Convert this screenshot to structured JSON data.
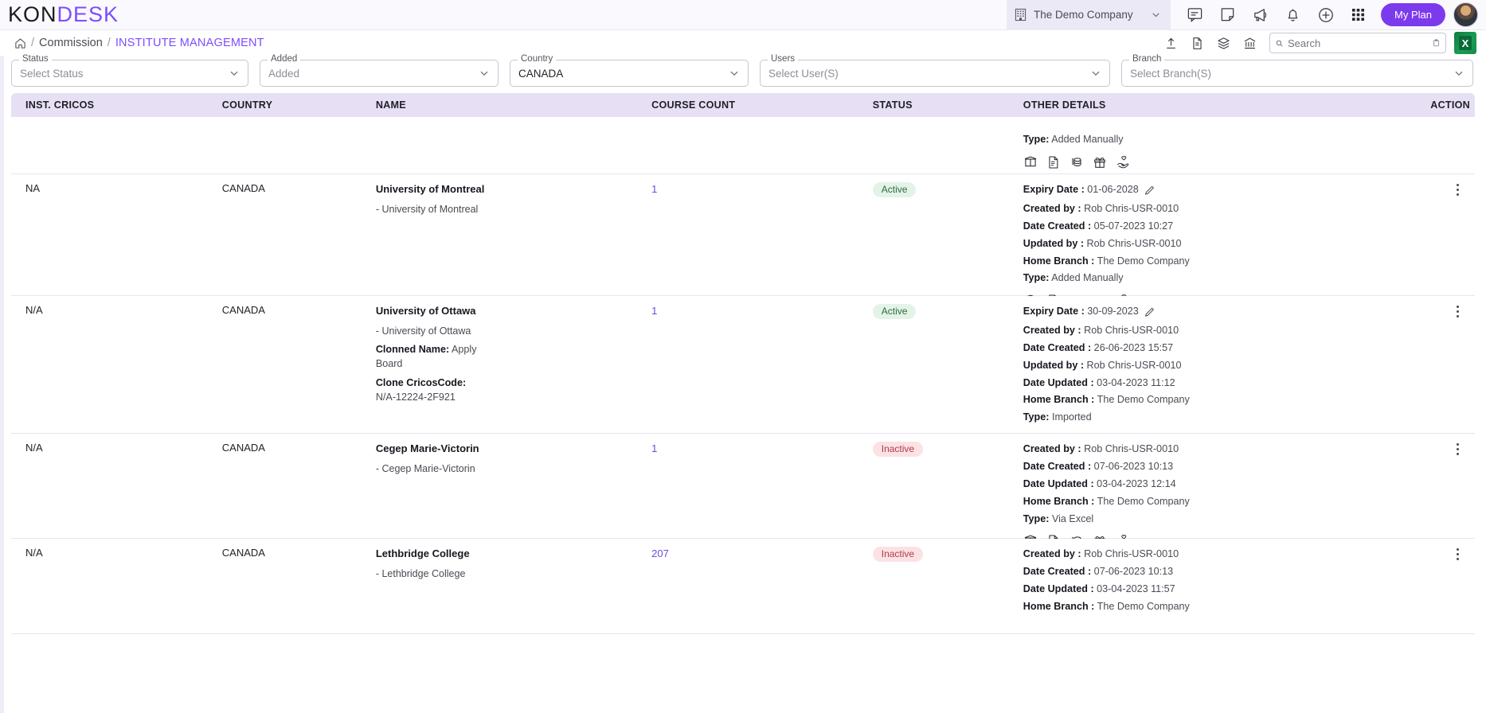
{
  "app": {
    "logo_left": "KON",
    "logo_right": "DESK"
  },
  "topbar": {
    "company": "The Demo Company",
    "my_plan_label": "My Plan",
    "icons": [
      "building-icon",
      "chevron-down-icon",
      "chat-icon",
      "note-icon",
      "megaphone-icon",
      "bell-icon",
      "plus-circle-icon",
      "apps-grid-icon"
    ]
  },
  "breadcrumb": {
    "home": "home-icon",
    "sep": "/",
    "parent": "Commission",
    "current": "INSTITUTE MANAGEMENT"
  },
  "toolbar": {
    "icons": [
      "upload-icon",
      "file-info-icon",
      "stack-icon",
      "bank-icon"
    ],
    "search_placeholder": "Search",
    "search_value": "",
    "excel_label": "X"
  },
  "filters": [
    {
      "label": "Status",
      "value": "Select Status",
      "filled": false
    },
    {
      "label": "Added",
      "value": "Added",
      "filled": false
    },
    {
      "label": "Country",
      "value": "CANADA",
      "filled": true
    },
    {
      "label": "Users",
      "value": "Select User(S)",
      "filled": false
    },
    {
      "label": "Branch",
      "value": "Select Branch(S)",
      "filled": false
    }
  ],
  "table": {
    "columns": [
      "INST. CRICOS",
      "COUNTRY",
      "NAME",
      "COURSE COUNT",
      "STATUS",
      "OTHER DETAILS",
      "ACTION"
    ],
    "rows": [
      {
        "partial": true,
        "cricos": "",
        "country": "",
        "name": "",
        "name_sub": "",
        "count": "",
        "status": "",
        "details": [
          {
            "k": "Type:",
            "v": "Added Manually"
          }
        ],
        "show_icons": true
      },
      {
        "partial": false,
        "cricos": "NA",
        "country": "CANADA",
        "name": "University of Montreal",
        "name_sub": "- University of Montreal",
        "count": "1",
        "status": "Active",
        "expiry_label": "Expiry Date :",
        "expiry_value": "01-06-2028",
        "details": [
          {
            "k": "Created by :",
            "v": "Rob Chris-USR-0010"
          },
          {
            "k": "Date Created :",
            "v": "05-07-2023 10:27"
          },
          {
            "k": "Updated by :",
            "v": "Rob Chris-USR-0010"
          },
          {
            "k": "Home Branch :",
            "v": "The Demo Company"
          },
          {
            "k": "Type:",
            "v": "Added Manually"
          }
        ],
        "show_icons": true
      },
      {
        "partial": false,
        "cricos": "N/A",
        "country": "CANADA",
        "name": "University of Ottawa",
        "name_sub": "- University of Ottawa",
        "name_extra": [
          {
            "k": "Clonned Name:",
            "v": "Apply Board"
          },
          {
            "k": "Clone CricosCode:",
            "v": "N/A-12224-2F921"
          }
        ],
        "count": "1",
        "status": "Active",
        "expiry_label": "Expiry Date :",
        "expiry_value": "30-09-2023",
        "details": [
          {
            "k": "Created by :",
            "v": "Rob Chris-USR-0010"
          },
          {
            "k": "Date Created :",
            "v": "26-06-2023 15:57"
          },
          {
            "k": "Updated by :",
            "v": "Rob Chris-USR-0010"
          },
          {
            "k": "Date Updated :",
            "v": "03-04-2023 11:12"
          },
          {
            "k": "Home Branch :",
            "v": "The Demo Company"
          },
          {
            "k": "Type:",
            "v": "Imported"
          }
        ],
        "show_icons": true
      },
      {
        "partial": false,
        "cricos": "N/A",
        "country": "CANADA",
        "name": "Cegep Marie-Victorin",
        "name_sub": "- Cegep Marie-Victorin",
        "count": "1",
        "status": "Inactive",
        "details": [
          {
            "k": "Created by :",
            "v": "Rob Chris-USR-0010"
          },
          {
            "k": "Date Created :",
            "v": "07-06-2023 10:13"
          },
          {
            "k": "Date Updated :",
            "v": "03-04-2023 12:14"
          },
          {
            "k": "Home Branch :",
            "v": "The Demo Company"
          },
          {
            "k": "Type:",
            "v": "Via Excel"
          }
        ],
        "show_icons": true
      },
      {
        "partial": false,
        "cricos": "N/A",
        "country": "CANADA",
        "name": "Lethbridge College",
        "name_sub": "- Lethbridge College",
        "count": "207",
        "status": "Inactive",
        "details": [
          {
            "k": "Created by :",
            "v": "Rob Chris-USR-0010"
          },
          {
            "k": "Date Created :",
            "v": "07-06-2023 10:13"
          },
          {
            "k": "Date Updated :",
            "v": "03-04-2023 11:57"
          },
          {
            "k": "Home Branch :",
            "v": "The Demo Company"
          }
        ],
        "show_icons": false
      }
    ],
    "row_action_icons": [
      "book-icon",
      "document-icon",
      "coins-icon",
      "gift-icon",
      "hand-heart-icon"
    ]
  },
  "colors": {
    "accent": "#7c4dff",
    "header_bg": "#e7e0f5",
    "active_badge": "#e4f3e8",
    "inactive_badge": "#fbe2e4"
  }
}
